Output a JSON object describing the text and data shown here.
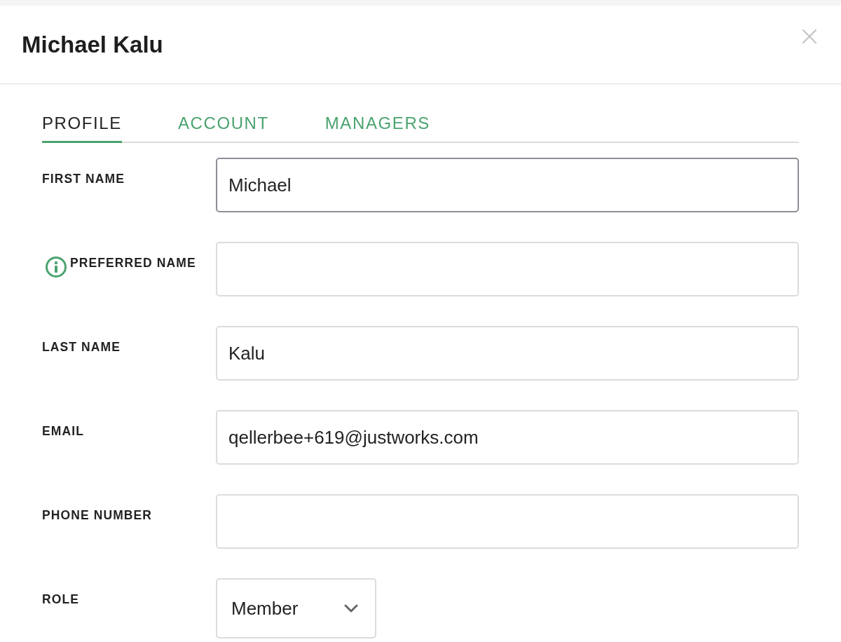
{
  "dialog": {
    "title": "Michael Kalu"
  },
  "tabs": [
    {
      "label": "PROFILE",
      "selected": true
    },
    {
      "label": "ACCOUNT",
      "selected": false
    },
    {
      "label": "MANAGERS",
      "selected": false
    }
  ],
  "fields": [
    {
      "kind": "text",
      "label": "FIRST NAME",
      "value": "Michael",
      "focused": true,
      "info": false
    },
    {
      "kind": "text",
      "label": "PREFERRED NAME",
      "focused": false,
      "info": true
    },
    {
      "kind": "text",
      "label": "LAST NAME",
      "value": "Kalu",
      "focused": false,
      "info": false
    },
    {
      "kind": "text",
      "label": "EMAIL",
      "value": "qellerbee+619@justworks.com",
      "focused": false,
      "info": false
    },
    {
      "kind": "text",
      "label": "PHONE NUMBER",
      "focused": false,
      "info": false
    },
    {
      "kind": "select",
      "label": "ROLE",
      "value": "Member",
      "focused": false,
      "info": false
    }
  ]
}
